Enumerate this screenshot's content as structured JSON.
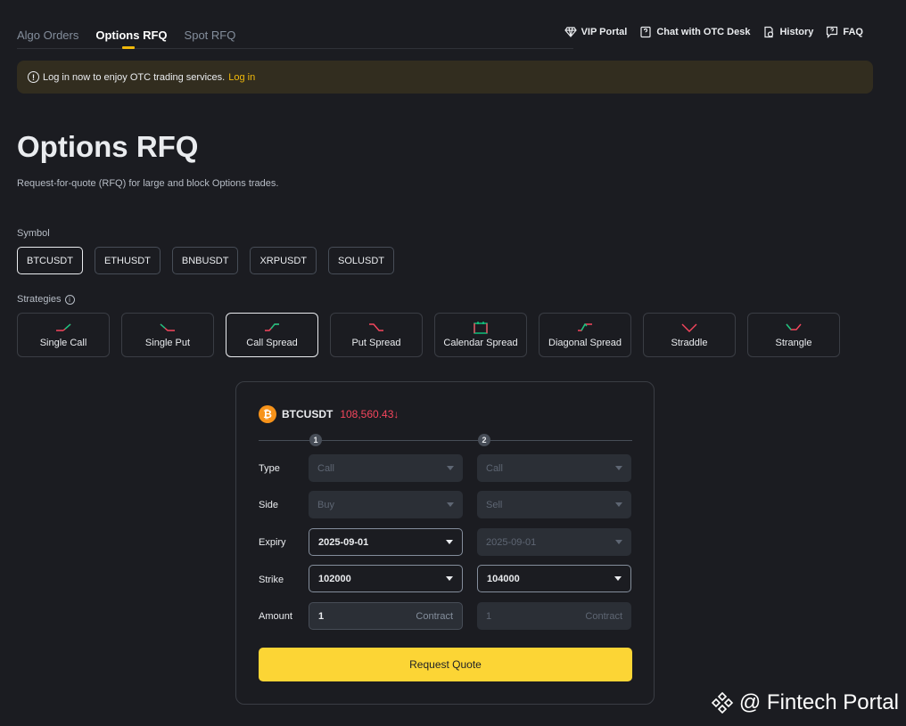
{
  "topnav": {
    "tabs": [
      {
        "label": "Algo Orders",
        "active": false
      },
      {
        "label": "Options RFQ",
        "active": true
      },
      {
        "label": "Spot RFQ",
        "active": false
      }
    ]
  },
  "toplinks": {
    "vip": "VIP Portal",
    "chat": "Chat with OTC Desk",
    "history": "History",
    "faq": "FAQ"
  },
  "banner": {
    "message": "Log in now to enjoy OTC trading services.",
    "link": "Log in"
  },
  "page": {
    "title": "Options RFQ",
    "description": "Request-for-quote (RFQ) for large and block Options trades."
  },
  "symbol_section": {
    "label": "Symbol",
    "items": [
      "BTCUSDT",
      "ETHUSDT",
      "BNBUSDT",
      "XRPUSDT",
      "SOLUSDT"
    ],
    "selected": "BTCUSDT"
  },
  "strategy_section": {
    "label": "Strategies",
    "items": [
      "Single Call",
      "Single Put",
      "Call Spread",
      "Put Spread",
      "Calendar Spread",
      "Diagonal Spread",
      "Straddle",
      "Strangle"
    ],
    "selected": "Call Spread"
  },
  "card": {
    "symbol": "BTCUSDT",
    "price": "108,560.43",
    "price_arrow": "↓",
    "leg1": "1",
    "leg2": "2",
    "rows": {
      "type": "Type",
      "side": "Side",
      "expiry": "Expiry",
      "strike": "Strike",
      "amount": "Amount"
    },
    "leg1_values": {
      "type": "Call",
      "side": "Buy",
      "expiry": "2025-09-01",
      "strike": "102000",
      "amount": "1",
      "unit": "Contract"
    },
    "leg2_values": {
      "type": "Call",
      "side": "Sell",
      "expiry": "2025-09-01",
      "strike": "104000",
      "amount": "1",
      "unit": "Contract"
    },
    "submit": "Request Quote"
  },
  "watermark": {
    "text": "@ Fintech Portal"
  },
  "colors": {
    "accent": "#fcd535",
    "brand_yellow": "#f0b90b",
    "price_down": "#f6465d",
    "background": "#1b1c21"
  }
}
